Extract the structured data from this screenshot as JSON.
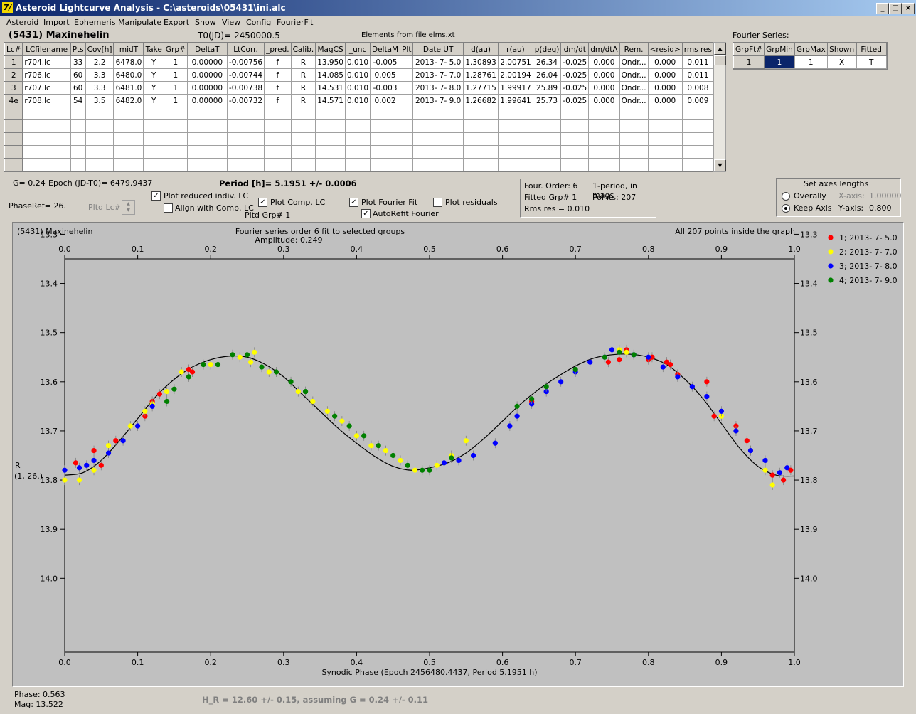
{
  "window": {
    "title": "Asteroid Lightcurve Analysis - C:\\asteroids\\05431\\ini.alc",
    "min": "_",
    "max": "□",
    "close": "×"
  },
  "menu": [
    "Asteroid",
    "Import",
    "Ephemeris",
    "Manipulate",
    "Export",
    "Show",
    "View",
    "Config",
    "FourierFit"
  ],
  "header": {
    "asteroid": "(5431) Maxinehelin",
    "t0": "T0(JD)= 2450000.5",
    "elements": "Elements from file elms.xt"
  },
  "lc_table": {
    "columns": [
      "Lc#",
      "LCfilename",
      "Pts",
      "Cov[h]",
      "midT",
      "Take",
      "Grp#",
      "DeltaT",
      "LtCorr.",
      "_pred.",
      "Calib.",
      "MagCS",
      "_unc",
      "DeltaM",
      "Plt",
      "Date UT",
      "d(au)",
      "r(au)",
      "p(deg)",
      "dm/dt",
      "dm/dtA",
      "Rem.",
      "<resid>",
      "rms res"
    ],
    "rows": [
      [
        "1",
        "r704.lc",
        "33",
        "2.2",
        "6478.0",
        "Y",
        "1",
        "0.00000",
        "-0.00756",
        "f",
        "R",
        "13.950",
        "0.010",
        "-0.005",
        "",
        "2013- 7- 5.0",
        "1.30893",
        "2.00751",
        "26.34",
        "-0.025",
        "0.000",
        "Ondr...",
        "0.000",
        "0.011"
      ],
      [
        "2",
        "r706.lc",
        "60",
        "3.3",
        "6480.0",
        "Y",
        "1",
        "0.00000",
        "-0.00744",
        "f",
        "R",
        "14.085",
        "0.010",
        "0.005",
        "",
        "2013- 7- 7.0",
        "1.28761",
        "2.00194",
        "26.04",
        "-0.025",
        "0.000",
        "Ondr...",
        "0.000",
        "0.011"
      ],
      [
        "3",
        "r707.lc",
        "60",
        "3.3",
        "6481.0",
        "Y",
        "1",
        "0.00000",
        "-0.00738",
        "f",
        "R",
        "14.531",
        "0.010",
        "-0.003",
        "",
        "2013- 7- 8.0",
        "1.27715",
        "1.99917",
        "25.89",
        "-0.025",
        "0.000",
        "Ondr...",
        "0.000",
        "0.008"
      ],
      [
        "4e",
        "r708.lc",
        "54",
        "3.5",
        "6482.0",
        "Y",
        "1",
        "0.00000",
        "-0.00732",
        "f",
        "R",
        "14.571",
        "0.010",
        "0.002",
        "",
        "2013- 7- 9.0",
        "1.26682",
        "1.99641",
        "25.73",
        "-0.025",
        "0.000",
        "Ondr...",
        "0.000",
        "0.009"
      ]
    ]
  },
  "fourier_series": {
    "label": "Fourier Series:",
    "columns": [
      "GrpFt#",
      "GrpMin",
      "GrpMax",
      "Shown",
      "Fitted"
    ],
    "row": [
      "1",
      "1",
      "1",
      "X",
      "T"
    ]
  },
  "controls": {
    "g": "G= 0.24",
    "epoch": "Epoch (JD-T0)= 6479.9437",
    "period": "Period [h]= 5.1951 +/- 0.0006",
    "phaseref": "PhaseRef= 26.",
    "pltd_lc": "Pltd Lc#:",
    "plot_reduced": "Plot reduced indiv. LC",
    "align_comp": "Align with Comp. LC",
    "plot_comp": "Plot Comp. LC",
    "pltd_grp": "Pltd Grp#  1",
    "plot_fourier": "Plot Fourier Fit",
    "autorefit": "AutoRefit Fourier",
    "plot_residuals": "Plot residuals",
    "check": "✓"
  },
  "fit_info": {
    "order": "Four. Order:  6",
    "mode": "1-period, in mags",
    "fitted": "Fitted Grp# 1",
    "points": "Points: 207",
    "rms": "Rms res     = 0.010"
  },
  "axes_box": {
    "title": "Set axes lengths",
    "overally": "Overally",
    "keep": "Keep Axis",
    "xaxis_label": "X-axis:",
    "xaxis_val": "1.00000",
    "yaxis_label": "Y-axis:",
    "yaxis_val": "0.800"
  },
  "status": {
    "phase": "Phase:  0.563",
    "mag": "Mag:    13.522",
    "hr": "H_R = 12.60 +/- 0.15, assuming G = 0.24 +/- 0.11"
  },
  "chart_data": {
    "type": "scatter",
    "title": "Fourier series order 6 fit to selected groups",
    "subtitle": "Amplitude: 0.249",
    "object": "(5431) Maxinehelin",
    "note": "All 207 points inside the graph",
    "xlabel": "Synodic Phase (Epoch 2456480.4437, Period 5.1951 h)",
    "ylabel": "R",
    "ylabel2": "(1, 26.)",
    "xlim": [
      0,
      1
    ],
    "ylim": [
      14.15,
      13.35
    ],
    "xticks": [
      "0.0",
      "0.1",
      "0.2",
      "0.3",
      "0.4",
      "0.5",
      "0.6",
      "0.7",
      "0.8",
      "0.9",
      "1.0"
    ],
    "yticks": [
      "13.3",
      "13.4",
      "13.5",
      "13.6",
      "13.7",
      "13.8",
      "13.9",
      "14.0"
    ],
    "fit": {
      "x": [
        0.0,
        0.025,
        0.05,
        0.075,
        0.1,
        0.125,
        0.15,
        0.175,
        0.2,
        0.225,
        0.25,
        0.275,
        0.3,
        0.325,
        0.35,
        0.375,
        0.4,
        0.425,
        0.45,
        0.475,
        0.5,
        0.525,
        0.55,
        0.575,
        0.6,
        0.625,
        0.65,
        0.675,
        0.7,
        0.725,
        0.75,
        0.775,
        0.8,
        0.825,
        0.85,
        0.875,
        0.9,
        0.925,
        0.95,
        0.975,
        1.0
      ],
      "y": [
        13.79,
        13.785,
        13.76,
        13.72,
        13.675,
        13.63,
        13.595,
        13.57,
        13.555,
        13.548,
        13.55,
        13.565,
        13.59,
        13.625,
        13.66,
        13.695,
        13.725,
        13.752,
        13.772,
        13.78,
        13.775,
        13.765,
        13.745,
        13.715,
        13.68,
        13.645,
        13.615,
        13.59,
        13.568,
        13.552,
        13.545,
        13.544,
        13.55,
        13.565,
        13.595,
        13.635,
        13.685,
        13.735,
        13.772,
        13.79,
        13.792
      ]
    },
    "series": [
      {
        "name": "1; 2013- 7- 5.0",
        "color": "#ff0000",
        "x": [
          0.015,
          0.04,
          0.05,
          0.07,
          0.11,
          0.12,
          0.13,
          0.17,
          0.175,
          0.64,
          0.745,
          0.76,
          0.77,
          0.8,
          0.805,
          0.825,
          0.83,
          0.84,
          0.88,
          0.89,
          0.92,
          0.935,
          0.97,
          0.985,
          0.995
        ],
        "y": [
          13.765,
          13.74,
          13.77,
          13.72,
          13.67,
          13.64,
          13.625,
          13.575,
          13.58,
          13.64,
          13.56,
          13.555,
          13.535,
          13.555,
          13.55,
          13.56,
          13.565,
          13.585,
          13.6,
          13.67,
          13.69,
          13.72,
          13.79,
          13.8,
          13.78
        ]
      },
      {
        "name": "2; 2013- 7- 7.0",
        "color": "#ffff00",
        "x": [
          0.0,
          0.02,
          0.04,
          0.06,
          0.09,
          0.11,
          0.12,
          0.14,
          0.16,
          0.2,
          0.24,
          0.255,
          0.26,
          0.28,
          0.32,
          0.34,
          0.36,
          0.38,
          0.4,
          0.42,
          0.44,
          0.46,
          0.48,
          0.51,
          0.53,
          0.55,
          0.76,
          0.77,
          0.9,
          0.92,
          0.94,
          0.96,
          0.97
        ],
        "y": [
          13.8,
          13.8,
          13.78,
          13.73,
          13.69,
          13.66,
          13.645,
          13.62,
          13.58,
          13.565,
          13.55,
          13.56,
          13.54,
          13.58,
          13.62,
          13.64,
          13.66,
          13.68,
          13.71,
          13.73,
          13.74,
          13.76,
          13.78,
          13.77,
          13.75,
          13.72,
          13.535,
          13.54,
          13.67,
          13.7,
          13.74,
          13.78,
          13.81
        ]
      },
      {
        "name": "3; 2013- 7- 8.0",
        "color": "#0000ff",
        "x": [
          0.0,
          0.02,
          0.03,
          0.04,
          0.06,
          0.08,
          0.1,
          0.12,
          0.52,
          0.54,
          0.56,
          0.59,
          0.61,
          0.62,
          0.64,
          0.66,
          0.68,
          0.7,
          0.72,
          0.74,
          0.75,
          0.78,
          0.8,
          0.82,
          0.84,
          0.86,
          0.88,
          0.9,
          0.92,
          0.94,
          0.96,
          0.98,
          0.99
        ],
        "y": [
          13.78,
          13.775,
          13.77,
          13.76,
          13.745,
          13.72,
          13.69,
          13.65,
          13.765,
          13.76,
          13.75,
          13.725,
          13.69,
          13.67,
          13.645,
          13.62,
          13.6,
          13.58,
          13.56,
          13.55,
          13.535,
          13.545,
          13.55,
          13.57,
          13.59,
          13.61,
          13.63,
          13.66,
          13.7,
          13.74,
          13.76,
          13.785,
          13.775
        ]
      },
      {
        "name": "4; 2013- 7- 9.0",
        "color": "#008000",
        "x": [
          0.14,
          0.15,
          0.17,
          0.19,
          0.21,
          0.23,
          0.25,
          0.27,
          0.29,
          0.31,
          0.33,
          0.37,
          0.39,
          0.41,
          0.43,
          0.45,
          0.47,
          0.49,
          0.5,
          0.53,
          0.62,
          0.64,
          0.66,
          0.7,
          0.74,
          0.76,
          0.78
        ],
        "y": [
          13.64,
          13.615,
          13.59,
          13.565,
          13.565,
          13.545,
          13.545,
          13.57,
          13.58,
          13.6,
          13.62,
          13.67,
          13.69,
          13.71,
          13.73,
          13.75,
          13.77,
          13.78,
          13.78,
          13.755,
          13.65,
          13.635,
          13.61,
          13.575,
          13.55,
          13.54,
          13.545
        ]
      }
    ]
  }
}
